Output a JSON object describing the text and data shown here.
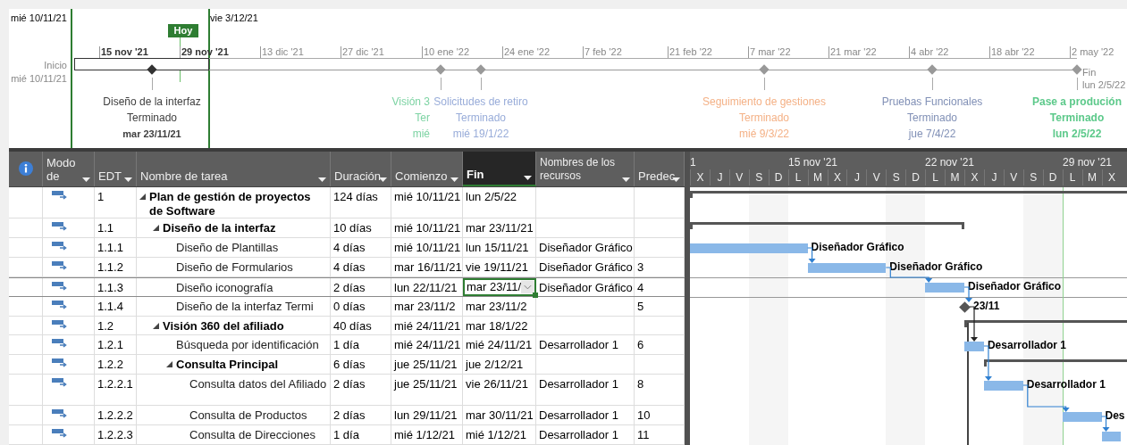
{
  "timeline": {
    "range_start": "mié 10/11/21",
    "range_end": "vie 3/12/21",
    "today": "Hoy",
    "start_label": "Inicio",
    "start_date": "mié 10/11/21",
    "end_label": "Fin",
    "end_date": "lun 2/5/22",
    "scale": [
      "15 nov '21",
      "29 nov '21",
      "13 dic '21",
      "27 dic '21",
      "10 ene '22",
      "24 ene '22",
      "7 feb '22",
      "21 feb '22",
      "7 mar '22",
      "21 mar '22",
      "4 abr '22",
      "18 abr '22",
      "2 may '22"
    ],
    "milestones": [
      {
        "name": "Diseño de la interfaz",
        "status": "Terminado",
        "date": "mar 23/11/21",
        "color": "#404040",
        "bold": false
      },
      {
        "name": "Visión 3",
        "status": "Ter",
        "date": "mié",
        "color": "#7dd3a3",
        "bold": false
      },
      {
        "name": "Solicitudes de retiro",
        "status": "Terminado",
        "date": "mié 19/1/22",
        "color": "#98acd9",
        "bold": false
      },
      {
        "name": "Seguimiento de gestiones",
        "status": "Terminado",
        "date": "mié 9/3/22",
        "color": "#f4b186",
        "bold": false
      },
      {
        "name": "Pruebas Funcionales",
        "status": "Terminado",
        "date": "jue 7/4/22",
        "color": "#8190b6",
        "bold": false
      },
      {
        "name": "Pase a produción",
        "status": "Terminado",
        "date": "lun 2/5/22",
        "color": "#5cc98a",
        "bold": true
      }
    ]
  },
  "table": {
    "columns": [
      {
        "label": "Modo de",
        "selected": false
      },
      {
        "label": "EDT",
        "selected": false
      },
      {
        "label": "Nombre de tarea",
        "selected": false
      },
      {
        "label": "Duración",
        "selected": false
      },
      {
        "label": "Comienzo",
        "selected": false
      },
      {
        "label": "Fin",
        "selected": true
      },
      {
        "label": "Nombres de los recursos",
        "selected": false
      },
      {
        "label": "Predec",
        "selected": false
      }
    ],
    "tasks": [
      {
        "edt": "1",
        "name": "Plan de gestión de proyectos de Software",
        "duration": "124 días",
        "start": "mié 10/11/21",
        "finish": "lun 2/5/22",
        "kind": "summary",
        "expanded": true,
        "selected": false,
        "children": [
          {
            "edt": "1.1",
            "name": "Diseño de la interfaz",
            "duration": "10 días",
            "start": "mié 10/11/21",
            "finish": "mar 23/11/21",
            "kind": "summary",
            "expanded": true,
            "selected": false,
            "children": [
              {
                "edt": "1.1.1",
                "name": "Diseño de Plantillas",
                "duration": "4 días",
                "start": "mié 10/11/21",
                "finish": "lun 15/11/21",
                "resources": "Diseñador Gráfico",
                "kind": "task",
                "bar_label": "Diseñador Gráfico",
                "selected": false
              },
              {
                "edt": "1.1.2",
                "name": "Diseño de Formularios",
                "duration": "4 días",
                "start": "mar 16/11/21",
                "finish": "vie 19/11/21",
                "resources": "Diseñador Gráfico",
                "predecessors": "3",
                "kind": "task",
                "bar_label": "Diseñador Gráfico",
                "selected": false
              },
              {
                "edt": "1.1.3",
                "name": "Diseño iconografía",
                "duration": "2 días",
                "start": "lun 22/11/21",
                "finish": "mar 23/11/",
                "resources": "Diseñador Gráfico",
                "predecessors": "4",
                "kind": "task",
                "bar_label": "Diseñador Gráfico",
                "selected": true
              },
              {
                "edt": "1.1.4",
                "name": "Diseño de la interfaz Termi",
                "duration": "0 días",
                "start": "mar 23/11/2",
                "finish": "mar 23/11/2",
                "predecessors": "5",
                "kind": "milestone",
                "bar_label": "23/11",
                "selected": false
              }
            ]
          },
          {
            "edt": "1.2",
            "name": "Visión 360 del afiliado",
            "duration": "40 días",
            "start": "mié 24/11/21",
            "finish": "mar 18/1/22",
            "kind": "summary",
            "expanded": true,
            "selected": false,
            "children": [
              {
                "edt": "1.2.1",
                "name": "Búsqueda por identificación",
                "duration": "1 día",
                "start": "mié 24/11/21",
                "finish": "mié 24/11/21",
                "resources": "Desarrollador 1",
                "predecessors": "6",
                "kind": "task",
                "bar_label": "Desarrollador 1",
                "selected": false
              },
              {
                "edt": "1.2.2",
                "name": "Consulta Principal",
                "duration": "6 días",
                "start": "jue 25/11/21",
                "finish": "jue 2/12/21",
                "kind": "summary",
                "expanded": true,
                "selected": false,
                "children": [
                  {
                    "edt": "1.2.2.1",
                    "name": "Consulta datos del Afiliado",
                    "duration": "2 días",
                    "start": "jue 25/11/21",
                    "finish": "vie 26/11/21",
                    "resources": "Desarrollador 1",
                    "predecessors": "8",
                    "kind": "task",
                    "bar_label": "Desarrollador 1",
                    "selected": false
                  },
                  {
                    "edt": "1.2.2.2",
                    "name": "Consulta de Productos",
                    "duration": "2 días",
                    "start": "lun 29/11/21",
                    "finish": "mar 30/11/21",
                    "resources": "Desarrollador 1",
                    "predecessors": "10",
                    "kind": "task",
                    "bar_label": "Des",
                    "selected": false
                  },
                  {
                    "edt": "1.2.2.3",
                    "name": "Consulta de Direcciones",
                    "duration": "1 día",
                    "start": "mié 1/12/21",
                    "finish": "mié 1/12/21",
                    "resources": "Desarrollador 1",
                    "predecessors": "11",
                    "kind": "task",
                    "selected": false
                  }
                ]
              }
            ]
          }
        ]
      }
    ]
  },
  "gantt": {
    "weeks": [
      "1",
      "15 nov '21",
      "22 nov '21",
      "29 nov '21"
    ],
    "days": [
      "X",
      "J",
      "V",
      "S",
      "D",
      "L",
      "M",
      "X",
      "J",
      "V",
      "S",
      "D",
      "L",
      "M",
      "X",
      "J",
      "V",
      "S",
      "D",
      "L",
      "M",
      "X"
    ]
  }
}
